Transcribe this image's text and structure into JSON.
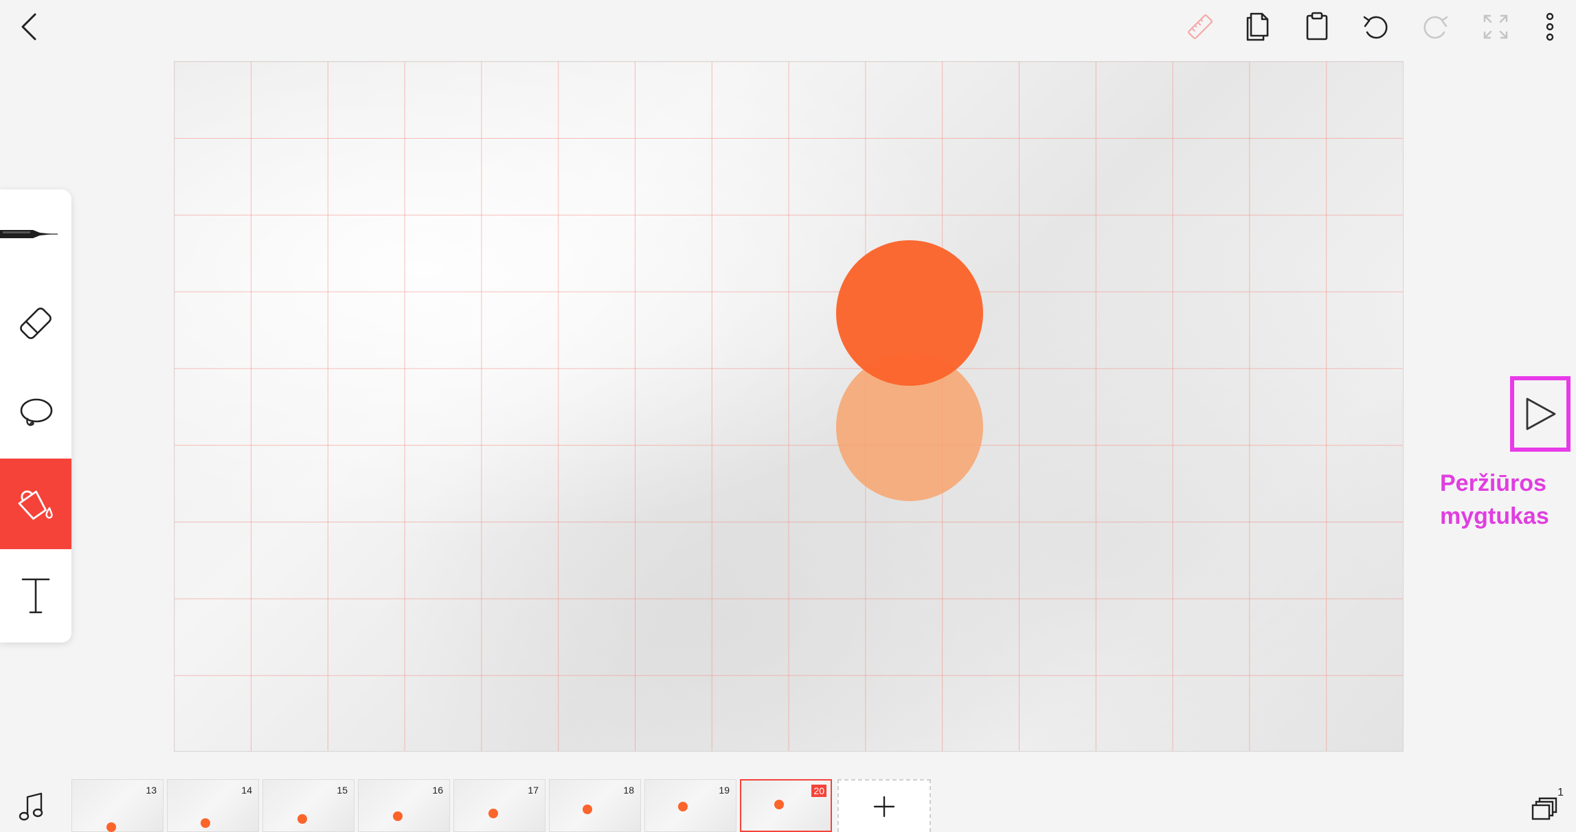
{
  "toolbar_top": {
    "back": "chevron-left-icon",
    "actions": [
      "ruler-icon",
      "copy-frame-icon",
      "paste-icon",
      "undo-icon",
      "redo-icon",
      "fullscreen-icon",
      "more-vertical-icon"
    ]
  },
  "tools": {
    "items": [
      "pen-tool-icon",
      "eraser-icon",
      "lasso-icon",
      "fill-bucket-icon",
      "text-tool-icon"
    ],
    "active": "fill-bucket-icon"
  },
  "preview": {
    "label_line1": "Peržiūros",
    "label_line2": "mygtukas"
  },
  "frames": [
    {
      "number": "13"
    },
    {
      "number": "14"
    },
    {
      "number": "15"
    },
    {
      "number": "16"
    },
    {
      "number": "17"
    },
    {
      "number": "18"
    },
    {
      "number": "19"
    },
    {
      "number": "20",
      "selected": true
    }
  ],
  "bottom": {
    "left_icon": "music-note-icon",
    "right_icon": "layers-icon",
    "layers_count": "1"
  },
  "colors": {
    "accent": "#f5433a",
    "ball": "#fb642b",
    "ball_onion": "#f9a066",
    "annotation": "#e83ae8"
  }
}
